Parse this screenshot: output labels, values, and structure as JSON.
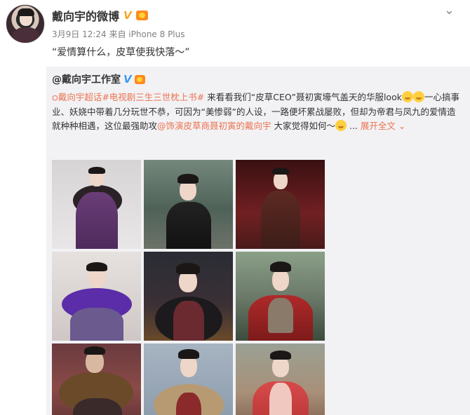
{
  "post": {
    "author": "戴向宇的微博",
    "verified_badge": "V",
    "meta": "3月9日 12:24 来自 iPhone 8 Plus",
    "text": "“爱情算什么，皮草使我快落～”"
  },
  "repost": {
    "author": "@戴向宇工作室",
    "verified_badge": "V",
    "text_parts": {
      "pin": "⛭",
      "link1": "戴向宇超话",
      "hashtag": "#电视剧三生三世枕上书#",
      "t1": " 来看看我们“皮草CEO”聂初寅壕气盖天的华服look",
      "t2": "一心搞事业、妖娆中带着几分玩世不恭，可因为“美惨弱”的人设，一路便坏累战屡败，但却为帝君与凤九的爱情造就种种相遇，这位最强助攻",
      "link2": "@饰演皮草商聂初寅的戴向宇",
      "t3": " 大家觉得如何～",
      "ellipsis": " ...",
      "expand": "展开全文",
      "expand_icon": "⌄"
    }
  },
  "icons": {
    "chevron": "⌄"
  },
  "colors": {
    "accent": "#eb7350",
    "verified_gold": "#f5a623",
    "verified_blue": "#3d9bf0",
    "repost_bg": "#f2f2f5"
  }
}
